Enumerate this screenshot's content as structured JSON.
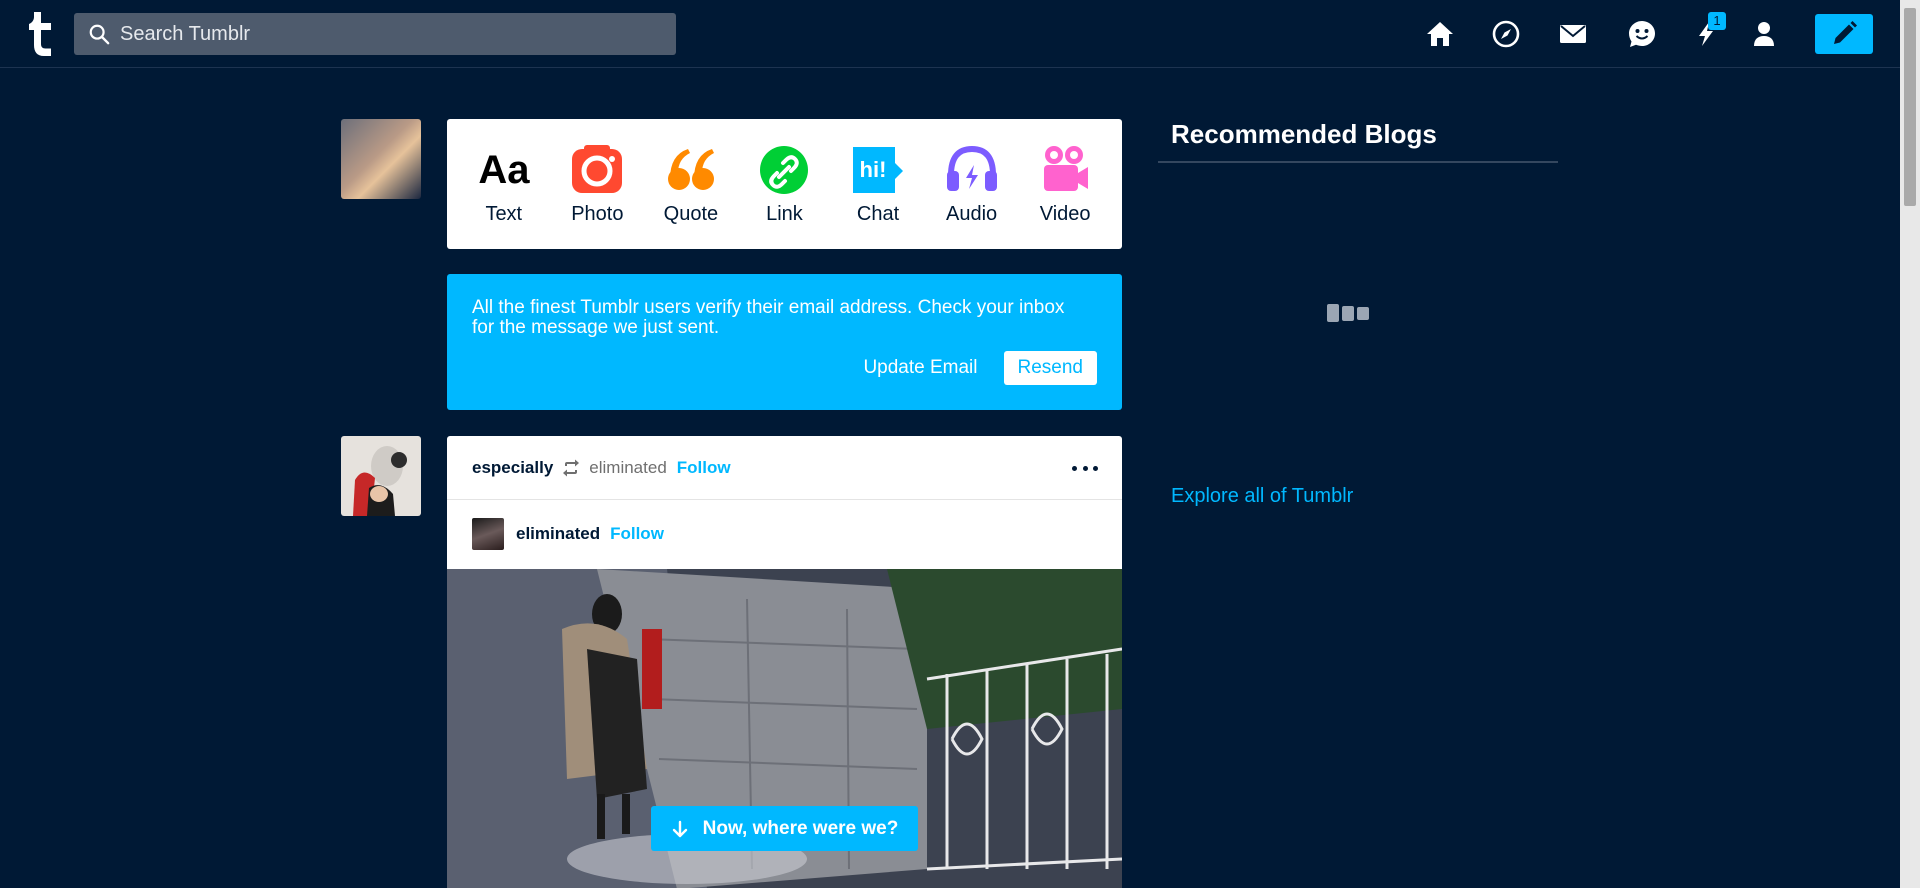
{
  "header": {
    "search_placeholder": "Search Tumblr",
    "activity_badge": "1",
    "icons": [
      "home-icon",
      "explore-icon",
      "inbox-icon",
      "messaging-icon",
      "activity-icon",
      "account-icon",
      "compose-pencil-icon"
    ]
  },
  "composer": {
    "types": [
      {
        "label": "Text",
        "icon": "text-aa-icon"
      },
      {
        "label": "Photo",
        "icon": "camera-icon",
        "color": "#ff4930"
      },
      {
        "label": "Quote",
        "icon": "quote-icon",
        "color": "#ff8a00"
      },
      {
        "label": "Link",
        "icon": "link-icon",
        "color": "#00cf35"
      },
      {
        "label": "Chat",
        "icon": "chat-hi-icon",
        "color": "#00b8ff"
      },
      {
        "label": "Audio",
        "icon": "headphones-icon",
        "color": "#7c5cff"
      },
      {
        "label": "Video",
        "icon": "video-camera-icon",
        "color": "#ff62ce"
      }
    ]
  },
  "verify": {
    "message": "All the finest Tumblr users verify their email address. Check your inbox for the message we just sent.",
    "update_label": "Update Email",
    "resend_label": "Resend"
  },
  "post": {
    "blog": "especially",
    "reblogged_from": "eliminated",
    "follow_label": "Follow",
    "original_blog": "eliminated",
    "original_follow_label": "Follow"
  },
  "jump_button": {
    "label": "Now, where were we?"
  },
  "sidebar": {
    "title": "Recommended Blogs",
    "explore_label": "Explore all of Tumblr"
  },
  "colors": {
    "background": "#001935",
    "accent": "#00b8ff"
  }
}
